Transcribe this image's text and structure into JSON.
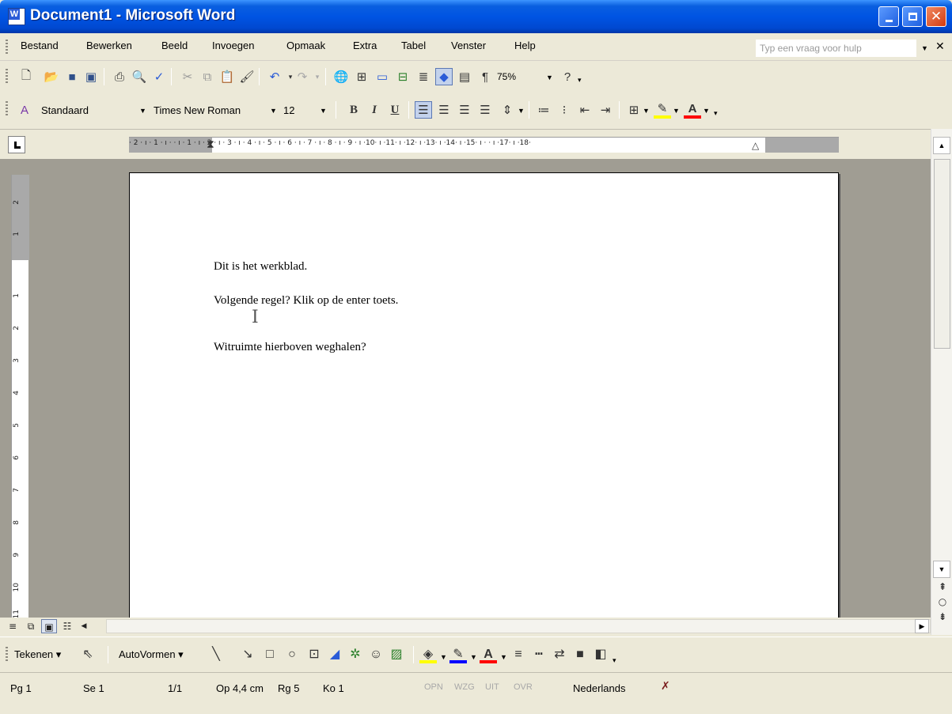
{
  "window": {
    "title": "Document1 - Microsoft Word"
  },
  "menu": {
    "items": [
      "Bestand",
      "Bewerken",
      "Beeld",
      "Invoegen",
      "Opmaak",
      "Extra",
      "Tabel",
      "Venster",
      "Help"
    ],
    "help_placeholder": "Typ een vraag voor hulp"
  },
  "standard_toolbar": {
    "zoom": "75%"
  },
  "formatting_toolbar": {
    "style": "Standaard",
    "font": "Times New Roman",
    "size": "12",
    "bold": "B",
    "italic": "I",
    "underline": "U"
  },
  "ruler": {
    "labels": "· 2 · ı · 1 · ı ·    · ı · 1 · ı · 2 · ı · 3 · ı · 4 · ı · 5 · ı · 6 · ı · 7 · ı · 8 · ı · 9 · ı ·10· ı ·11· ı ·12· ı ·13· ı ·14· ı ·15· ı ·   · ı ·17· ı ·18·"
  },
  "vertical_ruler": {
    "labels": [
      "2",
      "1",
      "1",
      "2",
      "3",
      "4",
      "5",
      "6",
      "7",
      "8",
      "9",
      "10",
      "11"
    ]
  },
  "document": {
    "paragraphs": [
      "Dit is het werkblad.",
      "Volgende regel? Klik op de enter toets.",
      "Witruimte hierboven weghalen?"
    ]
  },
  "drawing_toolbar": {
    "draw_label": "Tekenen",
    "autoshapes_label": "AutoVormen"
  },
  "status": {
    "page": "Pg 1",
    "section": "Se 1",
    "pages": "1/1",
    "at": "Op 4,4 cm",
    "line": "Rg 5",
    "column": "Ko 1",
    "rec": "OPN",
    "trk": "WZG",
    "ext": "UIT",
    "ovr": "OVR",
    "language": "Nederlands"
  },
  "icons": {
    "new": "new-document-icon",
    "open": "open-icon",
    "save": "save-icon",
    "permission": "permission-icon",
    "print": "print-icon",
    "preview": "print-preview-icon",
    "spelling": "spelling-icon",
    "cut": "cut-icon",
    "copy": "copy-icon",
    "paste": "paste-icon",
    "format_painter": "format-painter-icon",
    "undo": "undo-icon",
    "redo": "redo-icon",
    "hyperlink": "hyperlink-icon",
    "tables": "tables-icon",
    "insert_table": "insert-table-icon",
    "insert_excel": "insert-excel-icon",
    "columns": "columns-icon",
    "drawing": "drawing-icon",
    "document_map": "document-map-icon",
    "show_hide": "show-hide-icon",
    "help": "help-icon"
  },
  "colors": {
    "title_bar": "#0054e3",
    "chrome": "#ece9d8",
    "workspace": "#a09d93",
    "page": "#ffffff",
    "highlight": "#ffff00",
    "font_color": "#ff0000"
  }
}
